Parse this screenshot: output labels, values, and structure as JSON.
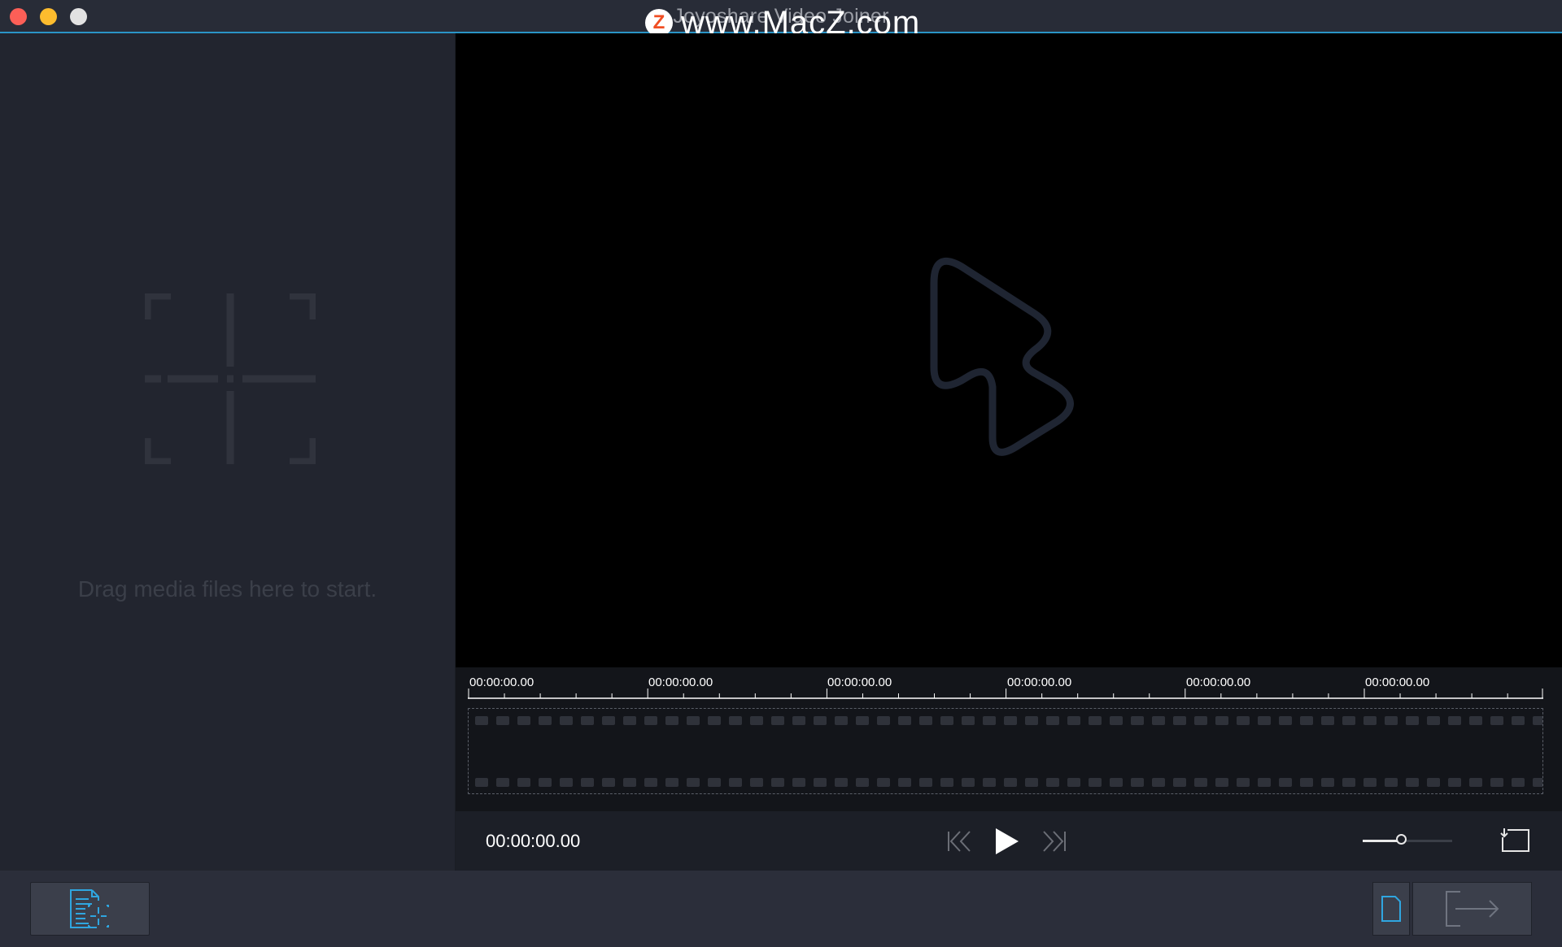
{
  "window": {
    "title": "Joyoshare Video Joiner",
    "watermark": {
      "badge": "Z",
      "text": "www.MacZ.com"
    }
  },
  "media_panel": {
    "placeholder_text": "Drag media files here to start."
  },
  "timeline": {
    "ruler_labels": [
      "00:00:00.00",
      "00:00:00.00",
      "00:00:00.00",
      "00:00:00.00",
      "00:00:00.00",
      "00:00:00.00"
    ]
  },
  "controls": {
    "timecode": "00:00:00.00",
    "volume_level": 0.43
  },
  "colors": {
    "accent": "#2a94c6",
    "icon_blue": "#2fa6e0",
    "background": "#1b1e25"
  },
  "icons": {
    "drop_target": "add-media-crosshair-icon",
    "preview": "cursor-pointer-icon",
    "rewind": "skip-back-icon",
    "play": "play-icon",
    "forward": "skip-forward-icon",
    "snapshot": "screen-export-icon",
    "add_files": "add-file-icon",
    "format": "format-file-icon",
    "convert": "convert-arrow-icon"
  }
}
